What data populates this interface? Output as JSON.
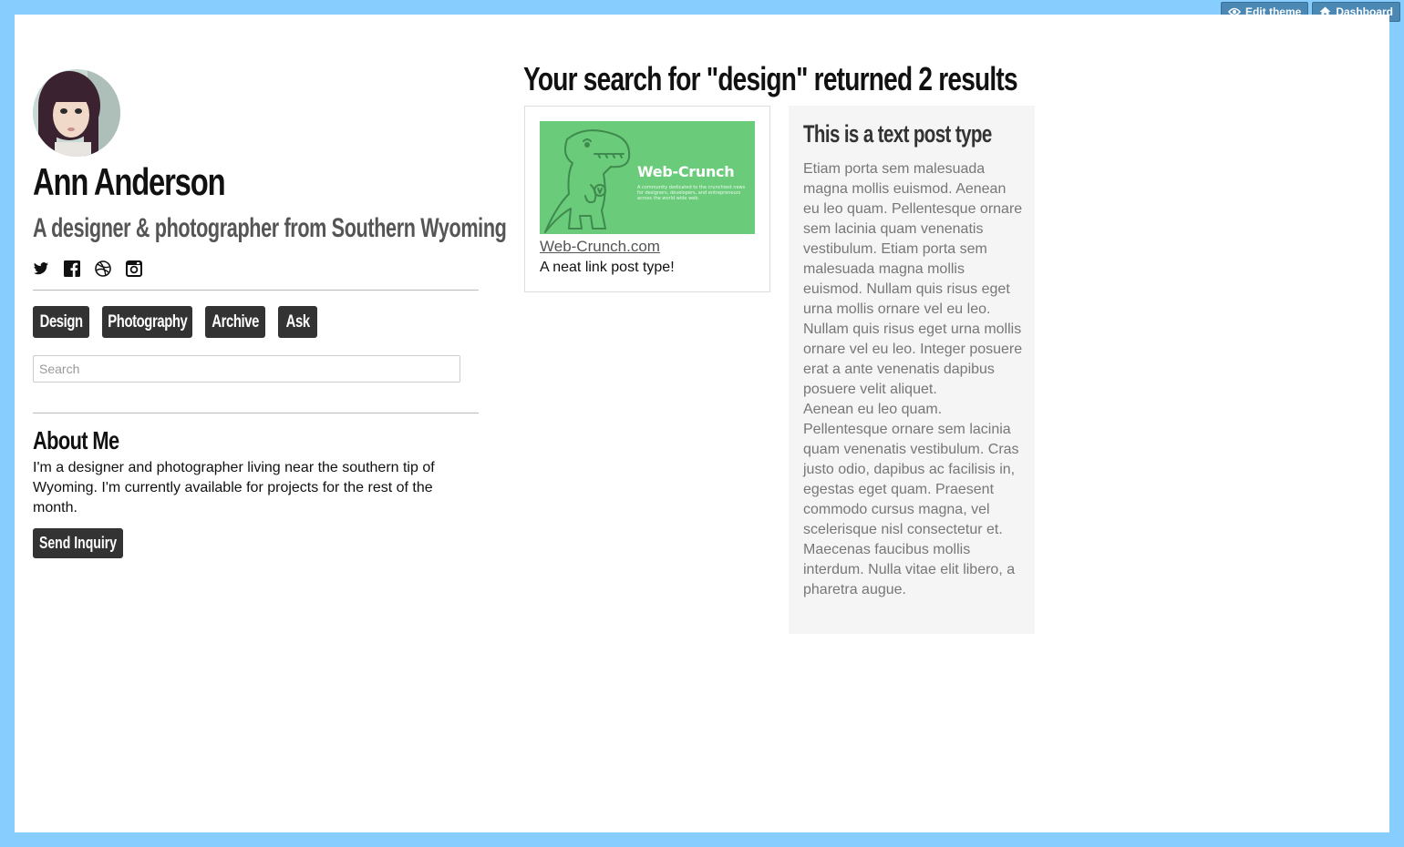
{
  "admin": {
    "edit_theme_label": "Edit theme",
    "dashboard_label": "Dashboard"
  },
  "profile": {
    "name": "Ann Anderson",
    "tagline": "A designer & photographer from Southern Wyoming",
    "social_icons": [
      "twitter-icon",
      "facebook-icon",
      "dribbble-icon",
      "instagram-icon"
    ]
  },
  "nav": {
    "items": [
      {
        "label": "Design"
      },
      {
        "label": "Photography"
      },
      {
        "label": "Archive"
      },
      {
        "label": "Ask"
      }
    ]
  },
  "search": {
    "placeholder": "Search",
    "value": ""
  },
  "about": {
    "heading": "About Me",
    "body": "I'm a designer and photographer living near the southern tip of Wyoming. I'm currently available for projects for the rest of the month.",
    "button_label": "Send Inquiry"
  },
  "results": {
    "heading": "Your search for \"design\" returned 2 results",
    "link_post": {
      "image_brand": "Web-Crunch",
      "image_tagline": "A community dedicated to the crunchiest news for designers, developers, and entrepreneurs across the world wide web.",
      "title": "Web-Crunch.com",
      "description": "A neat link post type!"
    },
    "text_post": {
      "title": "This is a text post type",
      "body": "Etiam porta sem malesuada magna mollis euismod. Aenean eu leo quam. Pellentesque ornare sem lacinia quam venenatis vestibulum. Etiam porta sem malesuada magna mollis euismod. Nullam quis risus eget urna mollis ornare vel eu leo. Nullam quis risus eget urna mollis ornare vel eu leo. Integer posuere erat a ante venenatis dapibus posuere velit aliquet.",
      "body2": "Aenean eu leo quam. Pellentesque ornare sem lacinia quam venenatis vestibulum. Cras justo odio, dapibus ac facilisis in, egestas eget quam. Praesent commodo cursus magna, vel scelerisque nisl consectetur et. Maecenas faucibus mollis interdum. Nulla vitae elit libero, a pharetra augue."
    }
  },
  "colors": {
    "page_border": "#87cdfd",
    "button_dark": "#333333",
    "admin_button": "#4b88b3",
    "thumbnail_green": "#6acb7a",
    "text_card_bg": "#f5f5f5"
  }
}
